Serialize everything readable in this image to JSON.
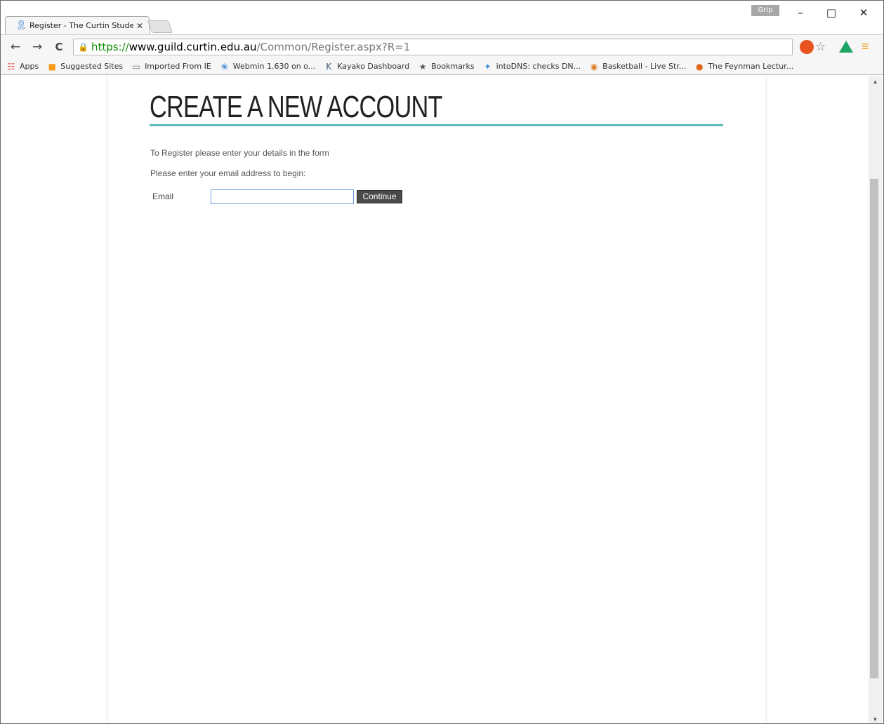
{
  "browser": {
    "tab_title": "Register - The Curtin Stude",
    "grip_label": "Grip",
    "window_controls": {
      "minimize": "–",
      "maximize": "□",
      "close": "✕"
    },
    "nav": {
      "back": "←",
      "forward": "→",
      "reload": "C"
    },
    "url": {
      "scheme": "https://",
      "host": "www.guild.curtin.edu.au",
      "path": "/Common/Register.aspx?R=1"
    },
    "bookmarks": [
      {
        "label": "Apps",
        "icon": "apps-grid-icon",
        "color": "#e8453c"
      },
      {
        "label": "Suggested Sites",
        "icon": "suggested-sites-icon",
        "color": "#f59a1a"
      },
      {
        "label": "Imported From IE",
        "icon": "folder-icon",
        "color": "#777777"
      },
      {
        "label": "Webmin 1.630 on o...",
        "icon": "webmin-icon",
        "color": "#4a90d9"
      },
      {
        "label": "Kayako Dashboard",
        "icon": "kayako-icon",
        "color": "#3f5871"
      },
      {
        "label": "Bookmarks",
        "icon": "star-icon",
        "color": "#555555"
      },
      {
        "label": "intoDNS: checks DN...",
        "icon": "intodns-icon",
        "color": "#3b8fd8"
      },
      {
        "label": "Basketball - Live Str...",
        "icon": "basketball-icon",
        "color": "#e07b20"
      },
      {
        "label": "The Feynman Lectur...",
        "icon": "feynman-icon",
        "color": "#e0661a"
      }
    ]
  },
  "page": {
    "heading": "CREATE A NEW ACCOUNT",
    "intro_line1": "To Register please enter your details in the form",
    "intro_line2": "Please enter your email address to begin:",
    "email_label": "Email",
    "email_value": "",
    "continue_label": "Continue",
    "accent_color": "#5bbcb8"
  }
}
